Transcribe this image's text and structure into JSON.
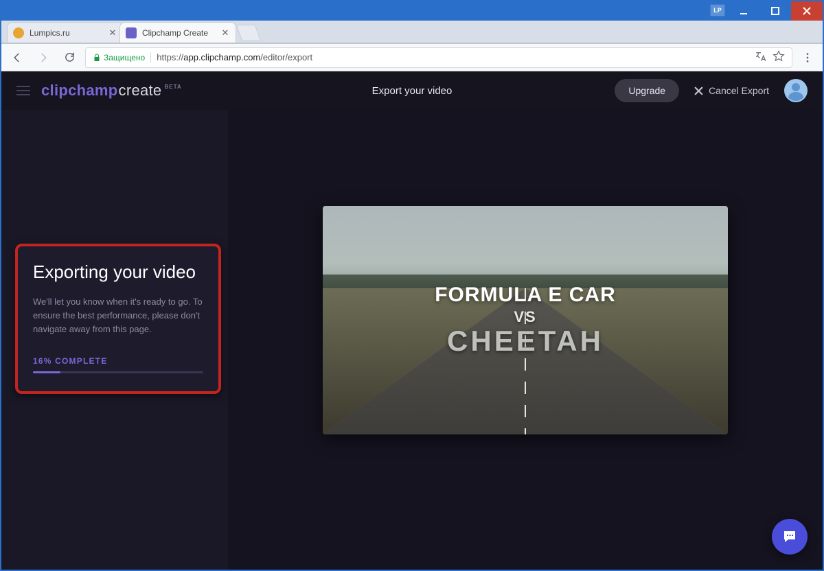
{
  "window": {
    "badge": "LP"
  },
  "tabs": [
    {
      "title": "Lumpics.ru",
      "active": false,
      "favicon": "#e7a531"
    },
    {
      "title": "Clipchamp Create",
      "active": true,
      "favicon": "#6b62c7"
    }
  ],
  "omnibox": {
    "secure_label": "Защищено",
    "scheme": "https",
    "host": "app.clipchamp.com",
    "path": "/editor/export"
  },
  "app": {
    "logo_a": "clipchamp",
    "logo_b": "create",
    "logo_beta": "BETA",
    "header_title": "Export your video",
    "upgrade": "Upgrade",
    "cancel_export": "Cancel Export"
  },
  "export_card": {
    "heading": "Exporting your video",
    "body": "We'll let you know when it's ready to go. To ensure the best performance, please don't navigate away from this page.",
    "percent_label": "16% COMPLETE",
    "percent": 16
  },
  "preview": {
    "line1": "FORMULA E CAR",
    "vs": "VS",
    "line2": "CHEETAH"
  }
}
